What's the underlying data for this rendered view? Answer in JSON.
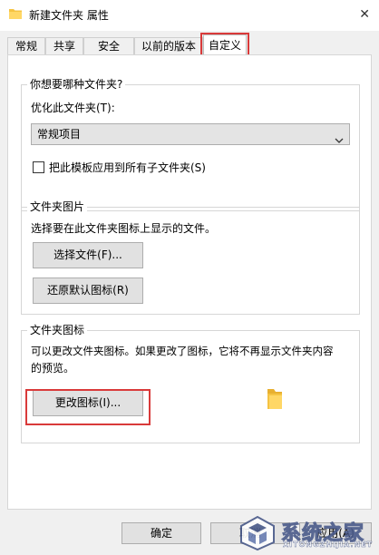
{
  "window": {
    "title": "新建文件夹 属性",
    "folder_icon": "folder-icon",
    "close_icon": "close-icon"
  },
  "tabs": [
    {
      "label": "常规"
    },
    {
      "label": "共享"
    },
    {
      "label": "安全"
    },
    {
      "label": "以前的版本"
    },
    {
      "label": "自定义",
      "active": true
    }
  ],
  "optimize_group": {
    "title": "你想要哪种文件夹?",
    "label": "优化此文件夹(T):",
    "selected": "常规项目",
    "apply_all": "把此模板应用到所有子文件夹(S)",
    "apply_all_checked": false
  },
  "pictures_group": {
    "title": "文件夹图片",
    "description": "选择要在此文件夹图标上显示的文件。",
    "choose_button": "选择文件(F)...",
    "restore_button": "还原默认图标(R)"
  },
  "icons_group": {
    "title": "文件夹图标",
    "description_line1": "可以更改文件夹图标。如果更改了图标，它将不再显示文件夹内容",
    "description_line2": "的预览。",
    "change_button": "更改图标(I)..."
  },
  "footer": {
    "ok": "确定",
    "cancel": "取消",
    "apply": "应用(A)"
  },
  "watermark": {
    "text": "系统之家",
    "url": "XITONGZHIJIA.NET"
  },
  "colors": {
    "highlight": "#d93a3a",
    "folder": "#f5c342"
  }
}
